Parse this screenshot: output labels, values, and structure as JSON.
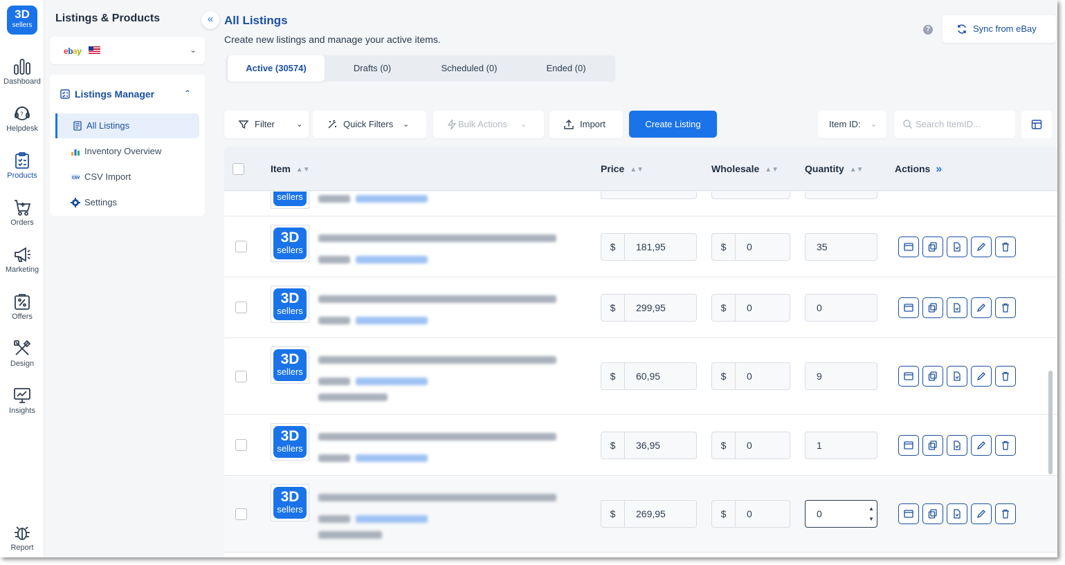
{
  "rail": {
    "logo_big": "3D",
    "logo_small": "sellers",
    "items": [
      {
        "label": "Dashboard",
        "icon": "bar-chart-icon"
      },
      {
        "label": "Helpdesk",
        "icon": "headset-icon"
      },
      {
        "label": "Products",
        "icon": "clipboard-icon"
      },
      {
        "label": "Orders",
        "icon": "cart-icon"
      },
      {
        "label": "Marketing",
        "icon": "megaphone-icon"
      },
      {
        "label": "Offers",
        "icon": "percent-tag-icon"
      },
      {
        "label": "Design",
        "icon": "tools-icon"
      },
      {
        "label": "Insights",
        "icon": "monitor-chart-icon"
      },
      {
        "label": "Report",
        "icon": "bug-icon"
      }
    ]
  },
  "panel": {
    "title": "Listings & Products",
    "store_brand": "ebay",
    "store_flag": "us-flag-icon",
    "section": "Listings Manager",
    "items": [
      {
        "label": "All Listings",
        "active": true
      },
      {
        "label": "Inventory Overview"
      },
      {
        "label": "CSV Import"
      },
      {
        "label": "Settings"
      }
    ]
  },
  "main": {
    "title": "All Listings",
    "subtitle": "Create new listings and manage your active items.",
    "sync_label": "Sync from eBay",
    "help": "?",
    "tabs": [
      {
        "label": "Active (30574)",
        "active": true
      },
      {
        "label": "Drafts (0)"
      },
      {
        "label": "Scheduled (0)"
      },
      {
        "label": "Ended (0)"
      }
    ],
    "toolbar": {
      "filter": "Filter",
      "quick_filters": "Quick Filters",
      "bulk_actions": "Bulk Actions",
      "import": "Import",
      "create": "Create Listing",
      "search_field": "Item ID:",
      "search_placeholder": "Search ItemID..."
    },
    "columns": {
      "item": "Item",
      "price": "Price",
      "wholesale": "Wholesale",
      "quantity": "Quantity",
      "actions": "Actions"
    },
    "currency": "$",
    "thumb_big": "3D",
    "thumb_small": "sellers",
    "rows": [
      {
        "price": "181,95",
        "wholesale": "0",
        "quantity": "35"
      },
      {
        "price": "299,95",
        "wholesale": "0",
        "quantity": "0"
      },
      {
        "price": "60,95",
        "wholesale": "0",
        "quantity": "9"
      },
      {
        "price": "36,95",
        "wholesale": "0",
        "quantity": "1"
      },
      {
        "price": "269,95",
        "wholesale": "0",
        "quantity": "0"
      }
    ],
    "colors": {
      "accent": "#1a73e8",
      "nav": "#1a4fa0"
    }
  }
}
